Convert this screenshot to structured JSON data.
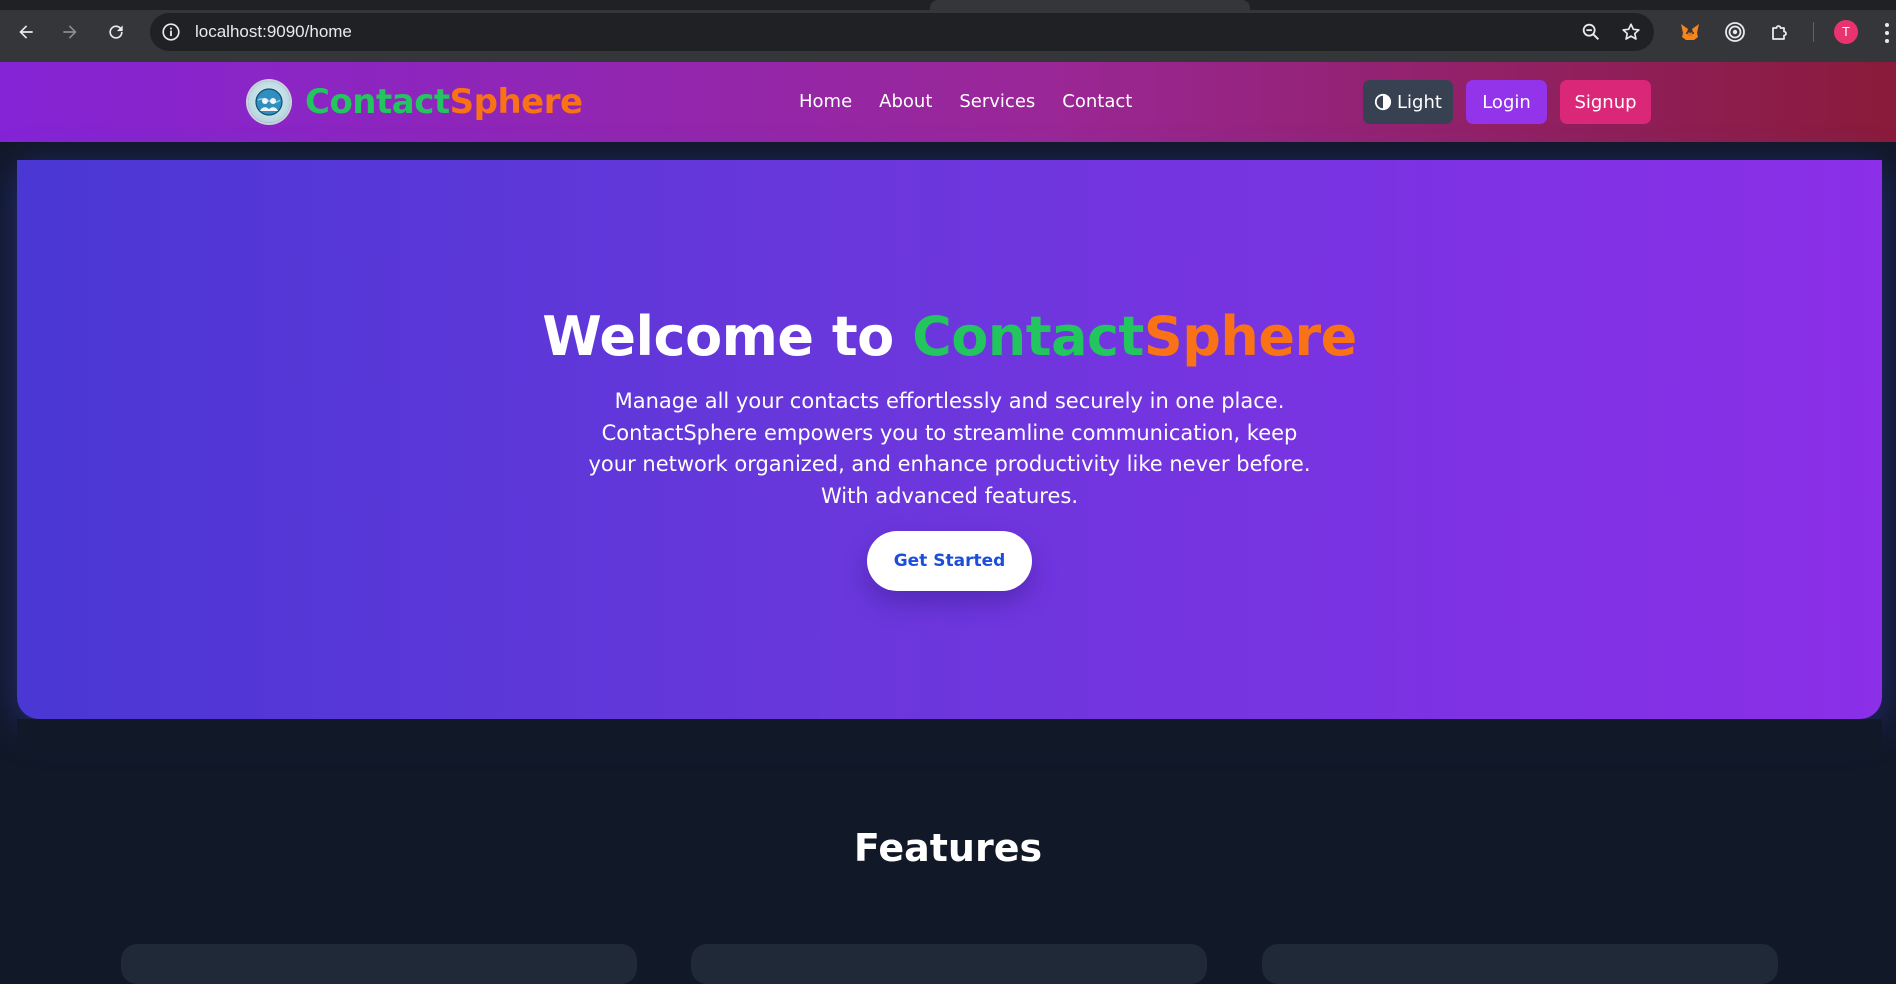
{
  "browser": {
    "url": "localhost:9090/home",
    "avatar_initial": "T",
    "icons": [
      "back-arrow-icon",
      "forward-arrow-icon",
      "reload-icon",
      "site-info-icon",
      "zoom-icon",
      "bookmark-star-icon",
      "metamask-fox-icon",
      "target-extension-icon",
      "extensions-puzzle-icon",
      "kebab-menu-icon"
    ]
  },
  "navbar": {
    "brand_part1": "Contact",
    "brand_part2": "Sphere",
    "links": [
      "Home",
      "About",
      "Services",
      "Contact"
    ],
    "theme_label": "Light",
    "login_label": "Login",
    "signup_label": "Signup"
  },
  "hero": {
    "title_prefix": "Welcome to ",
    "title_part1": "Contact",
    "title_part2": "Sphere",
    "description": "Manage all your contacts effortlessly and securely in one place. ContactSphere empowers you to streamline communication, keep your network organized, and enhance productivity like never before. With advanced features.",
    "cta_label": "Get Started"
  },
  "features": {
    "title": "Features"
  },
  "colors": {
    "brand_green": "#22c55e",
    "brand_orange": "#f97316",
    "login_purple": "#9333ea",
    "signup_pink": "#db2777",
    "page_bg": "#111827"
  }
}
